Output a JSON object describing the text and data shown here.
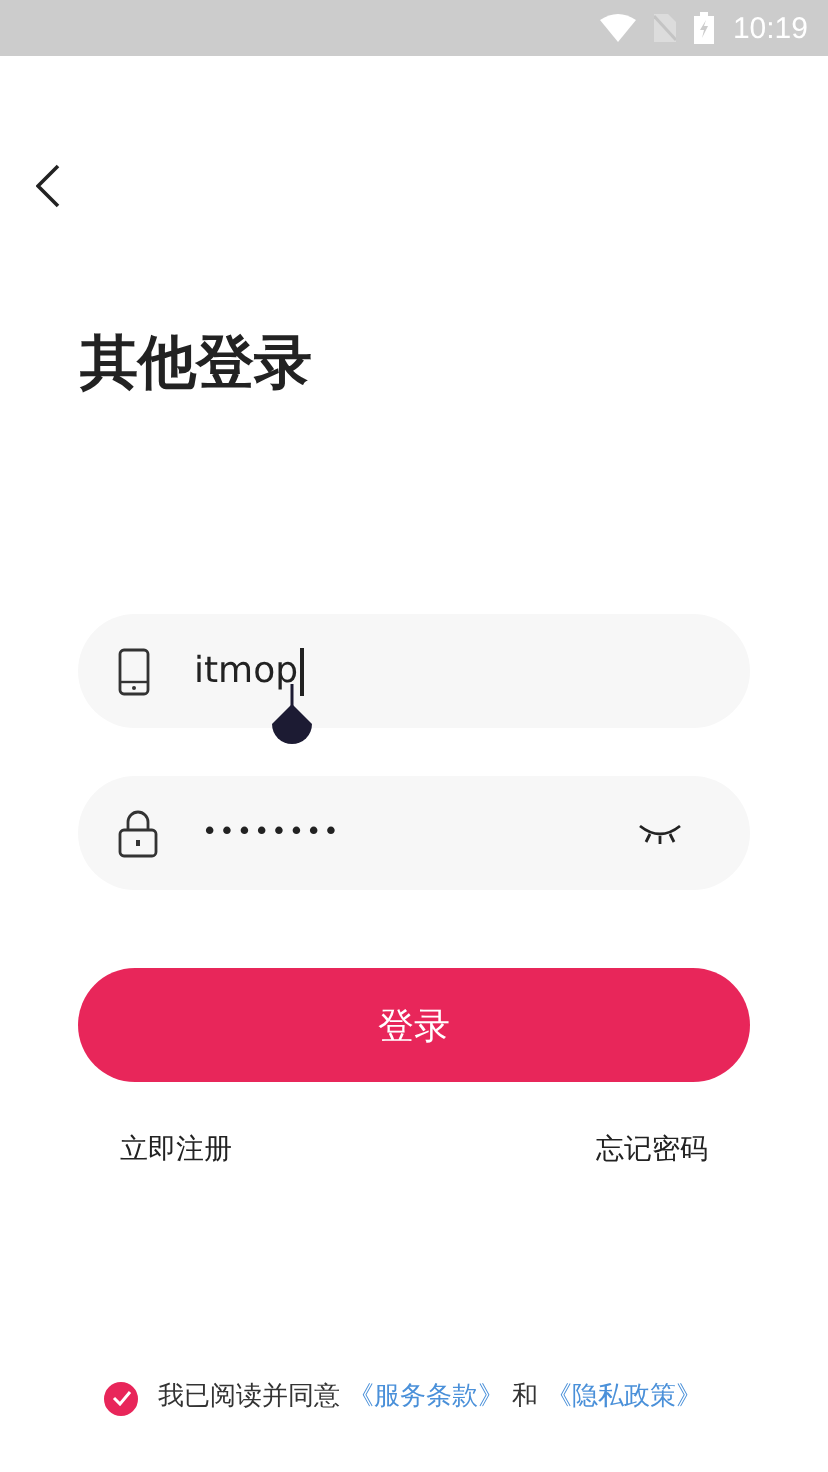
{
  "status_bar": {
    "time": "10:19"
  },
  "title": "其他登录",
  "phone_field": {
    "value": "itmop",
    "focused": true
  },
  "password_field": {
    "value": "••••••••",
    "password_visible": false
  },
  "login_button": "登录",
  "links": [
    "立即注册",
    "忘记密码"
  ],
  "agreement": {
    "checked": true,
    "text": "我已阅读并同意",
    "terms": "《服务条款》",
    "and": "和",
    "privacy": "《隐私政策》"
  }
}
